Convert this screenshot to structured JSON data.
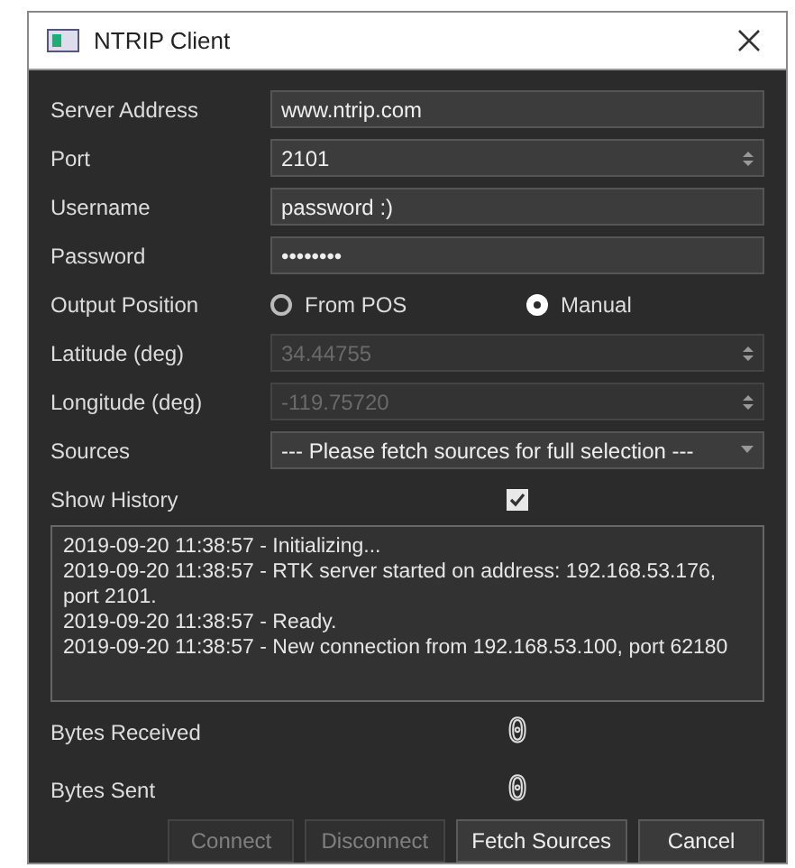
{
  "window": {
    "title": "NTRIP Client"
  },
  "fields": [
    {
      "kind": "text",
      "label": "Server Address",
      "value": "www.ntrip.com",
      "disabled": false
    },
    {
      "kind": "spin",
      "label": "Port",
      "value": "2101",
      "disabled": false
    },
    {
      "kind": "text",
      "label": "Username",
      "value": "password :)",
      "disabled": false
    },
    {
      "kind": "text",
      "label": "Password",
      "value": "••••••••",
      "disabled": false
    },
    {
      "kind": "radio",
      "label": "Output Position",
      "options": [
        {
          "label": "From POS",
          "selected": false
        },
        {
          "label": "Manual",
          "selected": true
        }
      ]
    },
    {
      "kind": "spin",
      "label": "Latitude (deg)",
      "value": "34.44755",
      "disabled": true
    },
    {
      "kind": "spin",
      "label": "Longitude (deg)",
      "value": "-119.75720",
      "disabled": true
    },
    {
      "kind": "dropdown",
      "label": "Sources",
      "value": "--- Please fetch sources for full selection ---",
      "disabled": false
    },
    {
      "kind": "checkbox",
      "label": "Show History",
      "checked": true
    }
  ],
  "log": [
    "2019-09-20 11:38:57 - Initializing...",
    "2019-09-20 11:38:57 - RTK server started on address: 192.168.53.176, port 2101.",
    "2019-09-20 11:38:57 - Ready.",
    "2019-09-20 11:38:57 - New connection from 192.168.53.100, port 62180"
  ],
  "counters": [
    {
      "label": "Bytes Received",
      "value": "0"
    },
    {
      "label": "Bytes Sent",
      "value": "0"
    }
  ],
  "buttons": [
    {
      "label": "Connect",
      "disabled": true
    },
    {
      "label": "Disconnect",
      "disabled": true
    },
    {
      "label": "Fetch Sources",
      "disabled": false
    },
    {
      "label": "Cancel",
      "disabled": false
    }
  ]
}
